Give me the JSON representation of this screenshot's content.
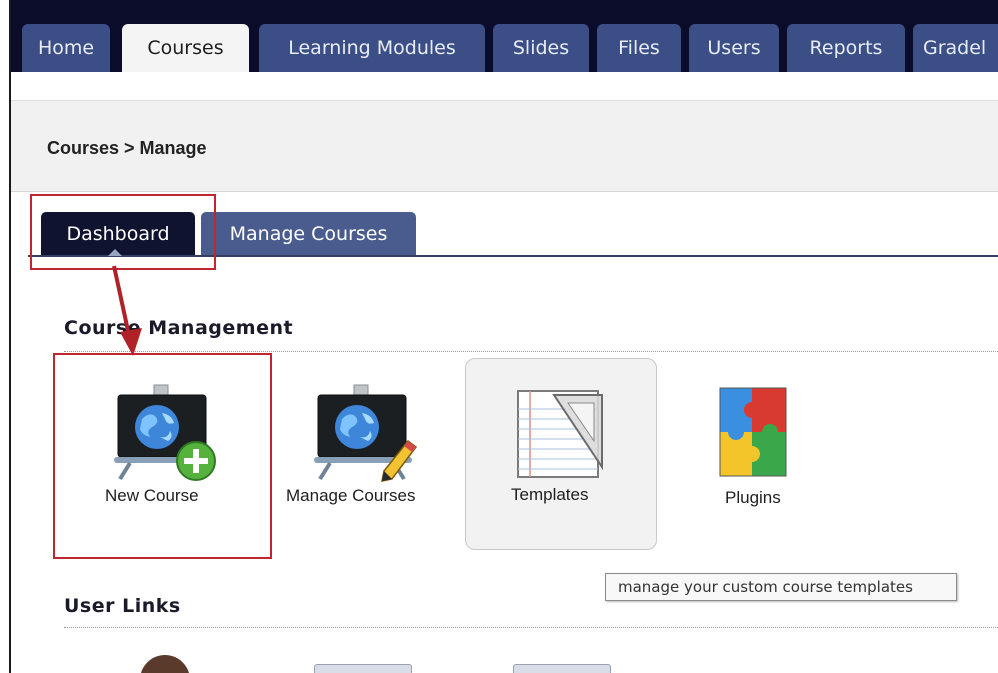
{
  "topnav": {
    "tabs": [
      {
        "label": "Home"
      },
      {
        "label": "Courses"
      },
      {
        "label": "Learning Modules"
      },
      {
        "label": "Slides"
      },
      {
        "label": "Files"
      },
      {
        "label": "Users"
      },
      {
        "label": "Reports"
      },
      {
        "label": "Gradel"
      }
    ],
    "active": "Courses"
  },
  "breadcrumb": "Courses > Manage",
  "subtabs": {
    "dashboard": "Dashboard",
    "manage_courses": "Manage Courses"
  },
  "course_management": {
    "title": "Course Management",
    "tiles": [
      {
        "label": "New Course",
        "icon": "new-course-icon"
      },
      {
        "label": "Manage Courses",
        "icon": "manage-courses-icon"
      },
      {
        "label": "Templates",
        "icon": "templates-icon"
      },
      {
        "label": "Plugins",
        "icon": "plugins-icon"
      }
    ]
  },
  "tooltip": "manage your custom course templates",
  "user_links": {
    "title": "User Links"
  },
  "colors": {
    "nav_bg": "#0b0b2a",
    "tab_bg": "#3b4e86",
    "annotation": "#c0262d"
  }
}
